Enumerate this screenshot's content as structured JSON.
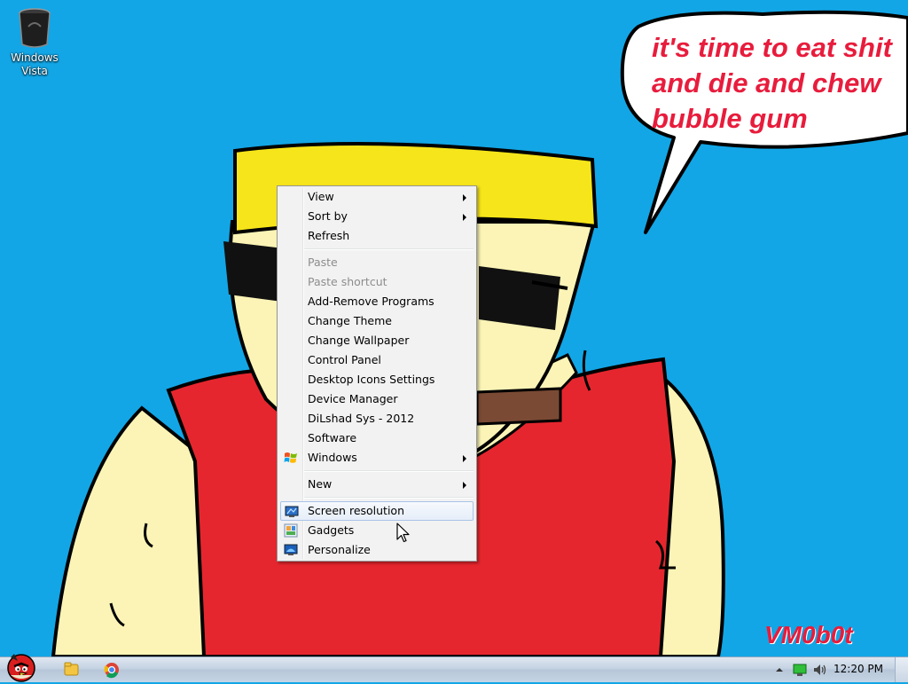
{
  "desktop": {
    "icons": [
      {
        "label": "Windows Vista",
        "icon": "recycle-bin-icon"
      }
    ]
  },
  "wallpaper": {
    "speech_lines": [
      "it's time to eat shit",
      "and die and chew",
      "bubble gum"
    ],
    "signature": "VM0b0t",
    "colors": {
      "sky": "#12a6e6",
      "text": "#e81c3c",
      "shirt": "#e6262e",
      "hair": "#f6e51a",
      "skin": "#fbf4b6"
    }
  },
  "context_menu": {
    "items": [
      {
        "label": "View",
        "submenu": true
      },
      {
        "label": "Sort by",
        "submenu": true
      },
      {
        "label": "Refresh"
      },
      {
        "separator": true
      },
      {
        "label": "Paste",
        "disabled": true
      },
      {
        "label": "Paste shortcut",
        "disabled": true
      },
      {
        "label": "Add-Remove Programs"
      },
      {
        "label": "Change Theme"
      },
      {
        "label": "Change Wallpaper"
      },
      {
        "label": "Control Panel"
      },
      {
        "label": "Desktop Icons Settings"
      },
      {
        "label": "Device Manager"
      },
      {
        "label": "DiLshad Sys - 2012"
      },
      {
        "label": "Software"
      },
      {
        "label": "Windows",
        "submenu": true,
        "icon": "windows-logo-icon"
      },
      {
        "separator": true
      },
      {
        "label": "New",
        "submenu": true
      },
      {
        "separator": true
      },
      {
        "label": "Screen resolution",
        "icon": "screen-resolution-icon",
        "hover": true
      },
      {
        "label": "Gadgets",
        "icon": "gadgets-icon"
      },
      {
        "label": "Personalize",
        "icon": "personalize-icon"
      }
    ]
  },
  "taskbar": {
    "start_icon": "angry-bird-start-icon",
    "pinned": [
      {
        "icon": "explorer-folder-icon"
      },
      {
        "icon": "chrome-icon"
      }
    ],
    "tray": {
      "icons": [
        "show-hidden-icons-icon",
        "network-icon",
        "volume-icon"
      ],
      "time": "12:20 PM"
    }
  }
}
